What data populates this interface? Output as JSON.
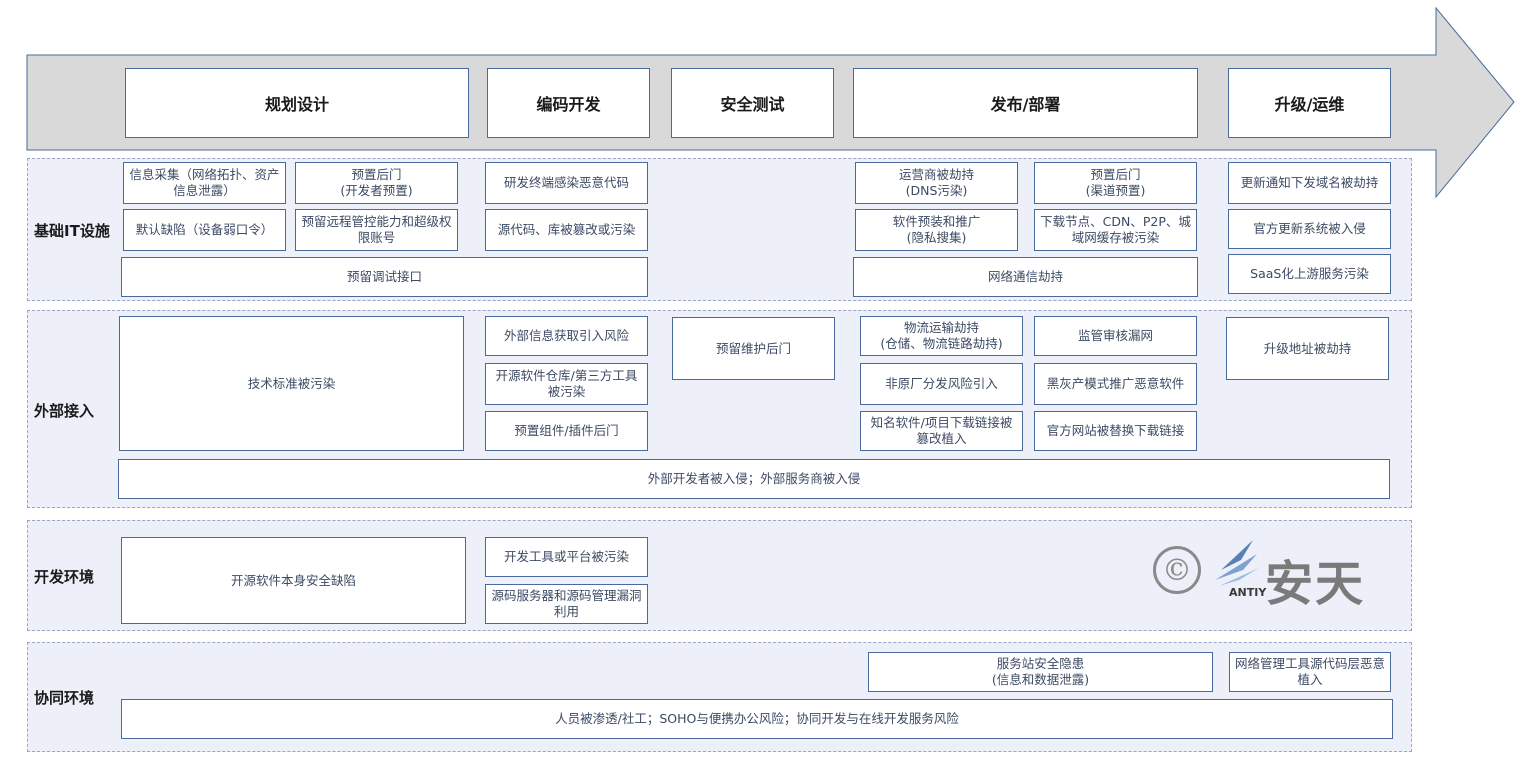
{
  "stages": [
    "规划设计",
    "编码开发",
    "安全测试",
    "发布/部署",
    "升级/运维"
  ],
  "rows": {
    "infra": "基础IT设施",
    "external": "外部接入",
    "devenv": "开发环境",
    "collab": "协同环境"
  },
  "infra": {
    "b1": "信息采集（网络拓扑、资产信息泄露）",
    "b2": "预置后门\n(开发者预置)",
    "b3": "默认缺陷（设备弱口令）",
    "b4": "预留远程管控能力和超级权限账号",
    "b5": "预留调试接口",
    "b6": "研发终端感染恶意代码",
    "b7": "源代码、库被篡改或污染",
    "b8": "运营商被劫持\n(DNS污染)",
    "b9": "预置后门\n(渠道预置)",
    "b10": "软件预装和推广\n(隐私搜集)",
    "b11": "下载节点、CDN、P2P、城域网缓存被污染",
    "b12": "网络通信劫持",
    "b13": "更新通知下发域名被劫持",
    "b14": "官方更新系统被入侵",
    "b15": "SaaS化上游服务污染"
  },
  "external": {
    "b1": "技术标准被污染",
    "b2": "外部信息获取引入风险",
    "b3": "开源软件仓库/第三方工具被污染",
    "b4": "预置组件/插件后门",
    "b5": "预留维护后门",
    "b6": "物流运输劫持\n(仓储、物流链路劫持)",
    "b7": "监管审核漏网",
    "b8": "非原厂分发风险引入",
    "b9": "黑灰产模式推广恶意软件",
    "b10": "知名软件/项目下载链接被篡改植入",
    "b11": "官方网站被替换下载链接",
    "b12": "升级地址被劫持",
    "b13": "外部开发者被入侵；外部服务商被入侵"
  },
  "devenv": {
    "b1": "开源软件本身安全缺陷",
    "b2": "开发工具或平台被污染",
    "b3": "源码服务器和源码管理漏洞利用"
  },
  "collab": {
    "b1": "服务站安全隐患\n(信息和数据泄露)",
    "b2": "网络管理工具源代码层恶意植入",
    "b3": "人员被渗透/社工；SOHO与便携办公风险；协同开发与在线开发服务风险"
  },
  "logo": {
    "copyright": "©",
    "brand": "安天",
    "sub": "ANTIY"
  },
  "colors": {
    "arrow_fill": "#d9d9d9",
    "band_fill": "#eef0f9",
    "border": "#4a6a9c"
  }
}
